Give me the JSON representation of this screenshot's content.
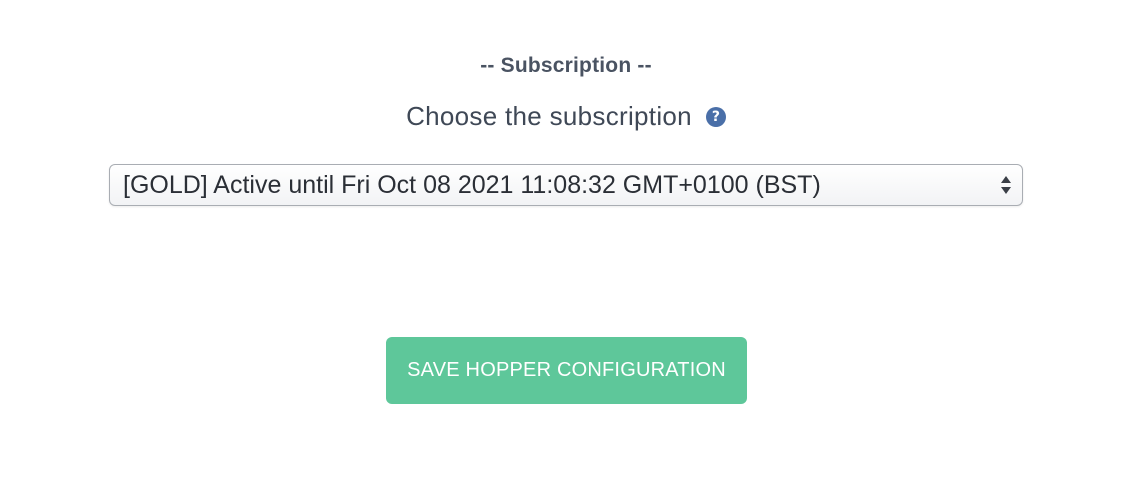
{
  "section": {
    "title": "-- Subscription --"
  },
  "subscription_field": {
    "label": "Choose the subscription",
    "help_icon_glyph": "?",
    "help_icon": "question-circle-icon",
    "selected_value": "[GOLD] Active until Fri Oct 08 2021 11:08:32 GMT+0100 (BST)",
    "arrows_icon": "select-updown-arrows-icon"
  },
  "actions": {
    "save_label": "SAVE HOPPER CONFIGURATION"
  },
  "colors": {
    "accent_button": "#5ec79a",
    "help_icon": "#4a6fa8",
    "text": "#3f4856"
  }
}
